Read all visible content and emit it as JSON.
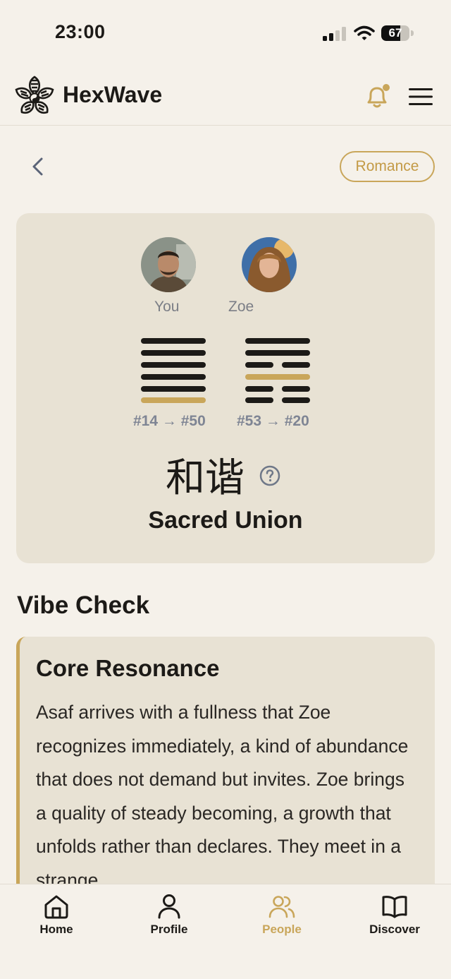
{
  "status_bar": {
    "time": "23:00",
    "battery_level": "67",
    "battery_percent": 67
  },
  "header": {
    "app_name": "HexWave",
    "logo_icon": "lotus-yin-yang-logo",
    "bell_icon": "bell-icon",
    "menu_icon": "hamburger-menu-icon",
    "has_notification": true
  },
  "top_row": {
    "back_icon": "chevron-left-icon",
    "category": "Romance"
  },
  "match": {
    "you_label": "You",
    "partner_label": "Zoe",
    "you_transition": "#14 → #50",
    "partner_transition": "#53 → #20",
    "chinese_name": "和谐",
    "english_name": "Sacred Union",
    "help_icon": "question-circle-icon"
  },
  "vibe_check": {
    "section_title": "Vibe Check",
    "card_title": "Core Resonance",
    "card_body": "Asaf arrives with a fullness that Zoe recognizes immediately, a kind of abundance that does not demand but invites. Zoe brings a quality of steady becoming, a growth that unfolds rather than declares. They meet in a strange"
  },
  "bottom_nav": {
    "items": [
      {
        "label": "Home",
        "icon": "home-icon"
      },
      {
        "label": "Profile",
        "icon": "person-icon"
      },
      {
        "label": "People",
        "icon": "people-icon"
      },
      {
        "label": "Discover",
        "icon": "open-book-icon"
      }
    ],
    "active": "People"
  },
  "colors": {
    "background": "#f5f1ea",
    "card": "#e8e2d4",
    "accent": "#c9a65a",
    "text": "#1c1a17",
    "muted": "#7f8594"
  }
}
